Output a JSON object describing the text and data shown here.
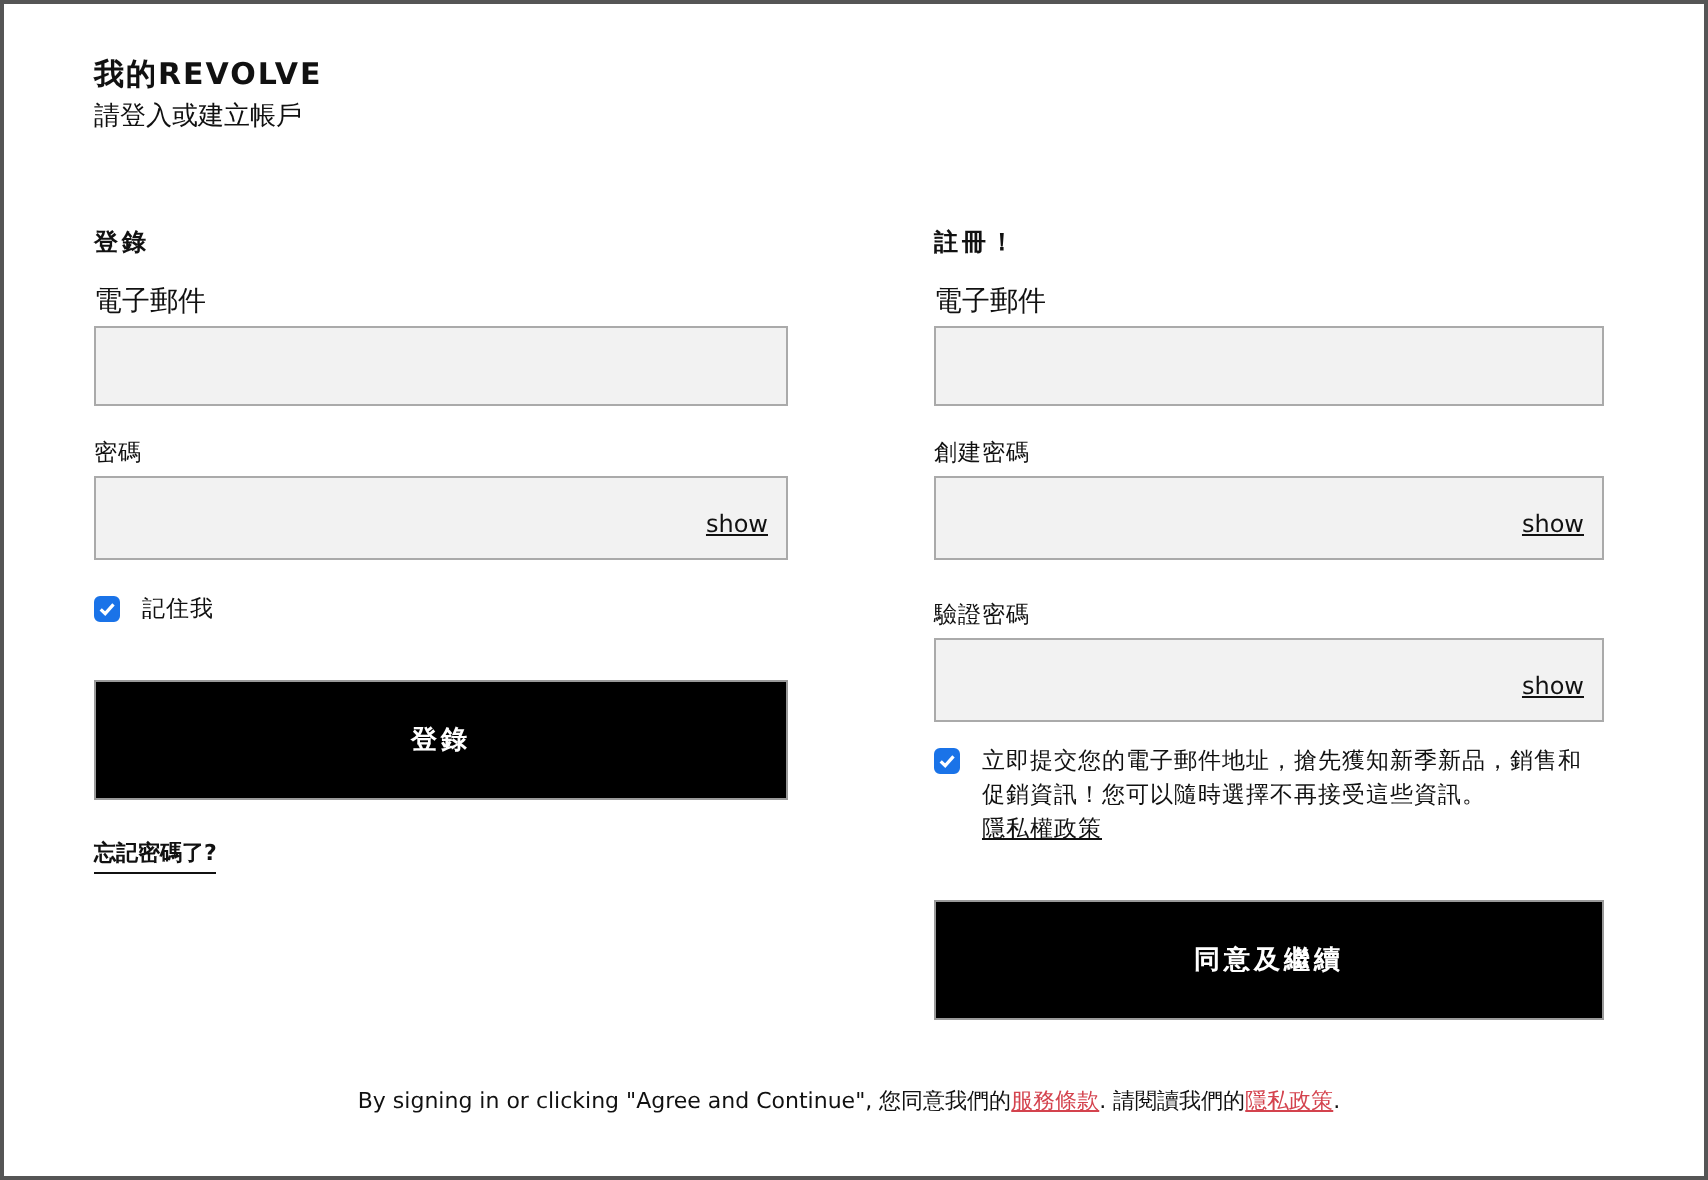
{
  "header": {
    "title": "我的REVOLVE",
    "subtitle": "請登入或建立帳戶"
  },
  "login": {
    "heading": "登錄",
    "fields": [
      {
        "kind": "email",
        "label": "電子郵件"
      },
      {
        "kind": "password",
        "label": "密碼",
        "toggle": "show"
      }
    ],
    "remember": {
      "label": "記住我",
      "checked": true
    },
    "button": "登錄",
    "forgot": "忘記密碼了?"
  },
  "register": {
    "heading": "註冊！",
    "fields": [
      {
        "kind": "email",
        "label": "電子郵件"
      },
      {
        "kind": "password",
        "label": "創建密碼",
        "toggle": "show"
      },
      {
        "kind": "password",
        "label": "驗證密碼",
        "toggle": "show"
      }
    ],
    "newsletter": {
      "text": "立即提交您的電子郵件地址，搶先獲知新季新品，銷售和促銷資訊！您可以隨時選擇不再接受這些資訊。",
      "link": "隱私權政策",
      "checked": true
    },
    "button": "同意及繼續"
  },
  "footer": {
    "segments": [
      {
        "kind": "text",
        "text": "By signing in or clicking \"Agree and Continue\", 您同意我們的"
      },
      {
        "kind": "link",
        "text": "服務條款"
      },
      {
        "kind": "text",
        "text": ". 請閱讀我們的"
      },
      {
        "kind": "link",
        "text": "隱私政策"
      },
      {
        "kind": "text",
        "text": "."
      }
    ]
  }
}
